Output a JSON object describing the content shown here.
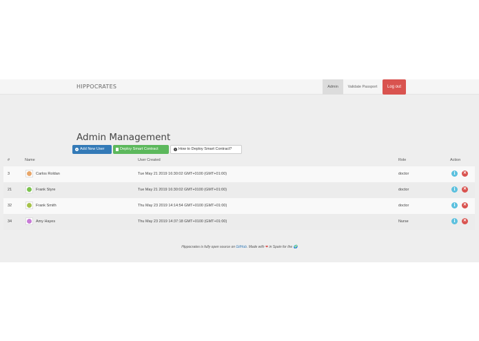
{
  "navbar": {
    "brand": "HIPPOCRATES",
    "admin": "Admin",
    "validate": "Validate Passport",
    "logout": "Log out"
  },
  "title": "Admin Management",
  "buttons": {
    "add_user": "Add New User",
    "deploy": "Deploy Smart Contract",
    "how_to": "How to Deploy Smart Contract?"
  },
  "table": {
    "headers": {
      "id": "#",
      "name": "Name",
      "created": "User Created",
      "role": "Role",
      "action": "Action"
    },
    "rows": [
      {
        "id": "3",
        "name": "Carlos Roldan",
        "created": "Tue May 21 2019 16:30:02 GMT+0100 (GMT+01:00)",
        "role": "doctor",
        "avatar_color": "#e8a66a"
      },
      {
        "id": "21",
        "name": "Frank Styre",
        "created": "Tue May 21 2019 16:30:02 GMT+0100 (GMT+01:00)",
        "role": "doctor",
        "avatar_color": "#7cc34f"
      },
      {
        "id": "32",
        "name": "Frank Smith",
        "created": "Thu May 23 2019 14:14:54 GMT+0100 (GMT+01:00)",
        "role": "doctor",
        "avatar_color": "#a5c24a"
      },
      {
        "id": "34",
        "name": "Amy Hayes",
        "created": "Thu May 23 2019 14:37:18 GMT+0100 (GMT+01:00)",
        "role": "Nurse",
        "avatar_color": "#c77bd6"
      }
    ]
  },
  "footer": {
    "prefix": "Hippocrates is fully open source on ",
    "link": "GitHub",
    "middle": ". Made with ",
    "heart": "❤",
    "suffix": " in Spain for the ",
    "globe": "🌍"
  },
  "colors": {
    "primary": "#337ab7",
    "success": "#5cb85c",
    "danger": "#d9534f",
    "info": "#5bc0de"
  }
}
